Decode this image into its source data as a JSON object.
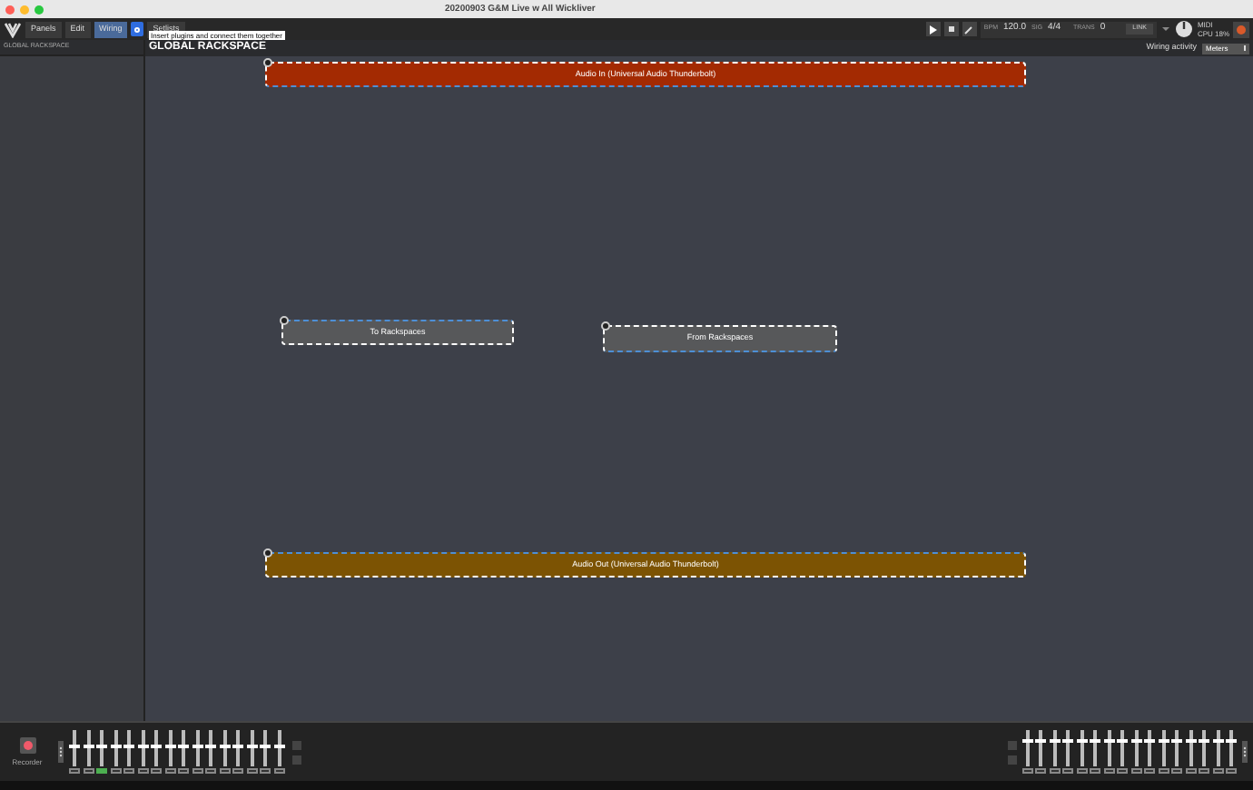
{
  "window": {
    "title": "20200903 G&M Live w All Wickliver"
  },
  "toolbar": {
    "tabs": [
      {
        "label": "Panels",
        "selected": false
      },
      {
        "label": "Edit",
        "selected": false
      },
      {
        "label": "Wiring",
        "selected": true
      },
      {
        "label": "Setlists",
        "selected": false
      }
    ],
    "tooltip": "Insert plugins and connect them together",
    "bpm_label": "BPM",
    "bpm": "120.0",
    "sig_label": "SIG",
    "sig": "4/4",
    "trans_label": "TRANS",
    "trans": "0",
    "link": "LINK",
    "midi": "MIDI",
    "cpu": "CPU 18%"
  },
  "sidebar": {
    "title": "GLOBAL RACKSPACE"
  },
  "canvas": {
    "title": "GLOBAL RACKSPACE",
    "wiring_label": "Wiring activity",
    "wiring_mode": "Meters",
    "nodes": [
      {
        "label": "Audio In (Universal Audio Thunderbolt)",
        "kind": "input",
        "color": "#a32a02"
      },
      {
        "label": "To Rackspaces",
        "kind": "to",
        "color": "#57585a"
      },
      {
        "label": "From Rackspaces",
        "kind": "from",
        "color": "#57585a"
      },
      {
        "label": "Audio Out (Universal Audio Thunderbolt)",
        "kind": "output",
        "color": "#7c5303"
      }
    ]
  },
  "mixer": {
    "recorder": "Recorder",
    "left_faders": [
      {
        "level": 0.55,
        "selected": false
      },
      {
        "level": 0.55,
        "selected": false
      },
      {
        "level": 0.55,
        "selected": true
      },
      {
        "level": 0.55,
        "selected": false
      },
      {
        "level": 0.55,
        "selected": false
      },
      {
        "level": 0.55,
        "selected": false
      },
      {
        "level": 0.55,
        "selected": false
      },
      {
        "level": 0.55,
        "selected": false
      },
      {
        "level": 0.55,
        "selected": false
      },
      {
        "level": 0.55,
        "selected": false
      },
      {
        "level": 0.55,
        "selected": false
      },
      {
        "level": 0.55,
        "selected": false
      },
      {
        "level": 0.55,
        "selected": false
      },
      {
        "level": 0.55,
        "selected": false
      },
      {
        "level": 0.55,
        "selected": false
      },
      {
        "level": 0.55,
        "selected": false
      }
    ],
    "right_faders": [
      {
        "level": 0.7
      },
      {
        "level": 0.7
      },
      {
        "level": 0.7
      },
      {
        "level": 0.7
      },
      {
        "level": 0.7
      },
      {
        "level": 0.7
      },
      {
        "level": 0.7
      },
      {
        "level": 0.7
      },
      {
        "level": 0.7
      },
      {
        "level": 0.7
      },
      {
        "level": 0.7
      },
      {
        "level": 0.7
      },
      {
        "level": 0.7
      },
      {
        "level": 0.7
      },
      {
        "level": 0.7
      },
      {
        "level": 0.7
      }
    ]
  }
}
